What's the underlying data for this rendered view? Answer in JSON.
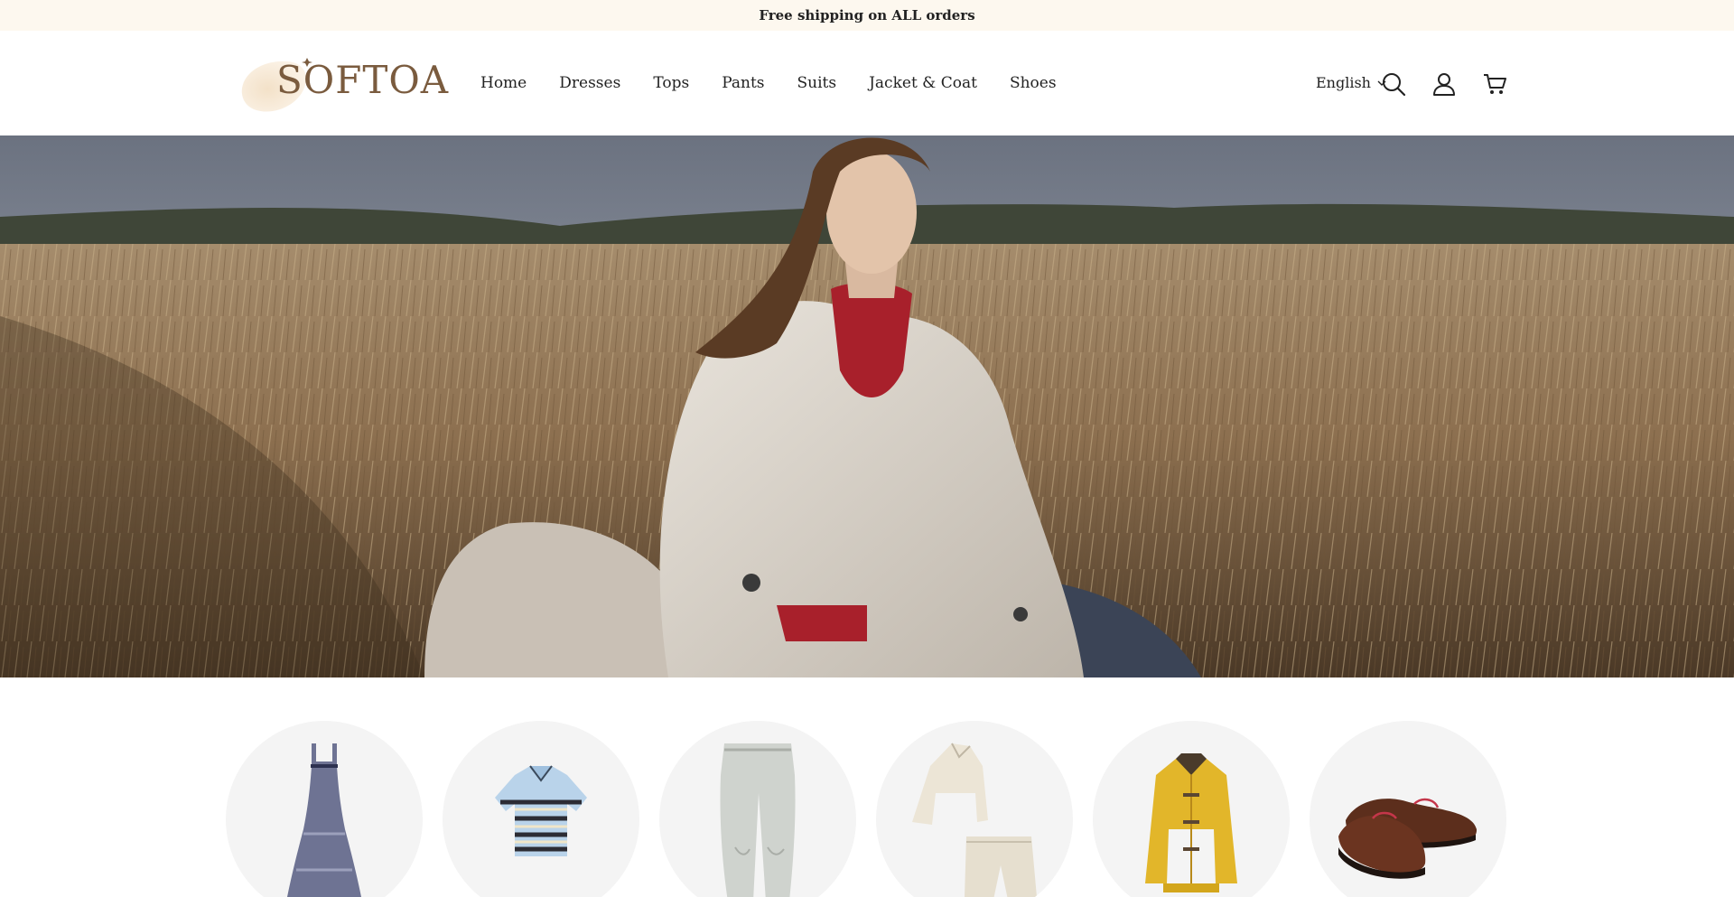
{
  "announcement": "Free shipping on ALL orders",
  "brand": {
    "name": "SOFTOA",
    "color": "#7a5b3e"
  },
  "nav": [
    {
      "label": "Home"
    },
    {
      "label": "Dresses"
    },
    {
      "label": "Tops"
    },
    {
      "label": "Pants"
    },
    {
      "label": "Suits"
    },
    {
      "label": "Jacket & Coat"
    },
    {
      "label": "Shoes"
    }
  ],
  "header": {
    "language": "English",
    "icons": [
      "chevron-down-icon",
      "search-icon",
      "account-icon",
      "cart-icon"
    ]
  },
  "hero": {
    "alt_subject": "woman in trench coat sitting in wheat field"
  },
  "categories": [
    {
      "icon": "dress-image"
    },
    {
      "icon": "striped-top-image"
    },
    {
      "icon": "jeans-image"
    },
    {
      "icon": "suit-set-image"
    },
    {
      "icon": "yellow-jacket-image"
    },
    {
      "icon": "loafers-image"
    }
  ],
  "colors": {
    "announcement_bg": "#fdf8ef",
    "text": "#222222",
    "category_bg": "#f4f4f4"
  }
}
